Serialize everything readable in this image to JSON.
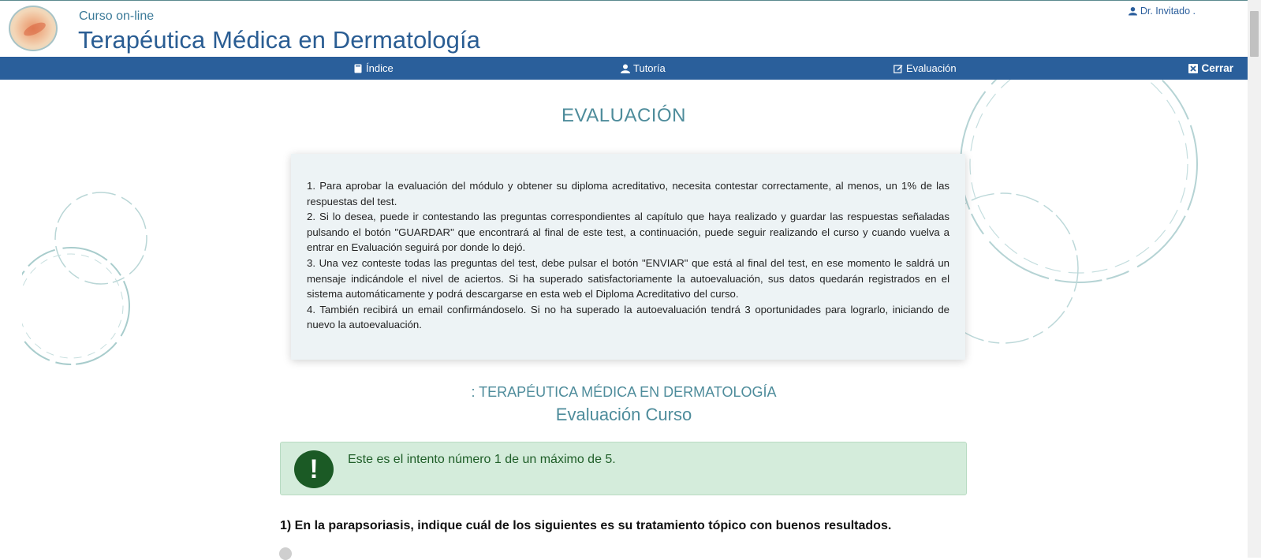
{
  "header": {
    "subtitle": "Curso on-line",
    "title": "Terapéutica Médica en Dermatología",
    "user": "Dr. Invitado ."
  },
  "navbar": {
    "indice": "Índice",
    "tutoria": "Tutoría",
    "evaluacion": "Evaluación",
    "cerrar": "Cerrar"
  },
  "main": {
    "heading": "EVALUACIÓN",
    "instructions": [
      "1. Para aprobar la evaluación del módulo y obtener su diploma acreditativo, necesita contestar correctamente, al menos, un 1% de las respuestas del test.",
      "2. Si lo desea, puede ir contestando las preguntas correspondientes al capítulo que haya realizado y guardar las respuestas señaladas pulsando el botón \"GUARDAR\" que encontrará al final de este test, a continuación, puede seguir realizando el curso y cuando vuelva a entrar en Evaluación seguirá por donde lo dejó.",
      "3. Una vez conteste todas las preguntas del test, debe pulsar el botón \"ENVIAR\" que está al final del test, en ese momento le saldrá un mensaje indicándole el nivel de aciertos. Si ha superado satisfactoriamente la autoevaluación, sus datos quedarán registrados en el sistema automáticamente y podrá descargarse en esta web el Diploma Acreditativo del curso.",
      "4. También recibirá un email confirmándoselo. Si no ha superado la autoevaluación tendrá 3 oportunidades para lograrlo, iniciando de nuevo la autoevaluación."
    ],
    "course_title": ": TERAPÉUTICA MÉDICA EN DERMATOLOGÍA",
    "course_subtitle": "Evaluación Curso",
    "alert_icon": "!",
    "alert_text": "Este es el intento número 1 de un máximo de 5.",
    "question_1": "1) En la parapsoriasis, indique cuál de los siguientes es su tratamiento tópico con buenos resultados."
  },
  "colors": {
    "navbar": "#2a5f9b",
    "title": "#2a5d93",
    "heading": "#4e8c9b",
    "alert_bg": "#d4ecdb",
    "alert_icon": "#1b5a25"
  }
}
